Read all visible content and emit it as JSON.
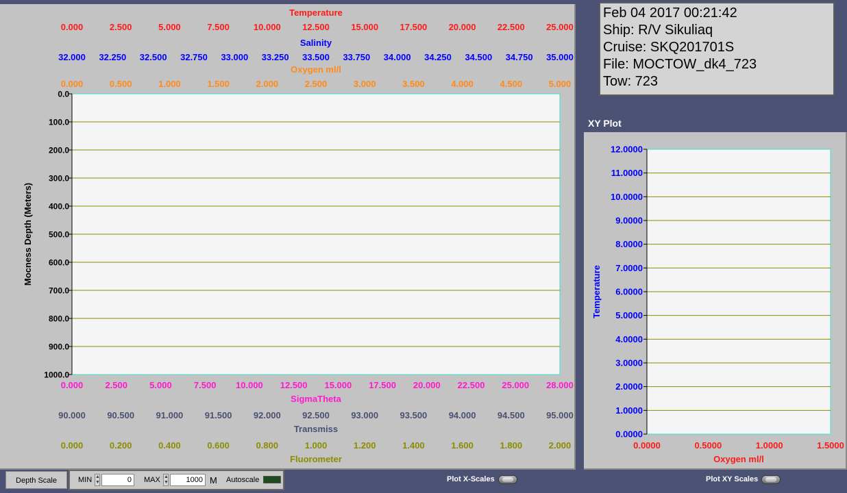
{
  "info": {
    "datetime": "Feb 04 2017 00:21:42",
    "ship": "Ship: R/V Sikuliaq",
    "cruise": "Cruise: SKQ201701S",
    "file": "File: MOCTOW_dk4_723",
    "tow": "Tow: 723"
  },
  "xy_panel_title": "XY Plot",
  "colors": {
    "temperature": "#ff1a1a",
    "salinity": "#0000ff",
    "oxygen": "#ff8a1a",
    "sigma_theta": "#ff1acd",
    "transmiss": "#4a5070",
    "fluorometer": "#8c8c00",
    "grid": "#8c8c00",
    "plot_bg": "#f5f5f5",
    "depth_axis": "#000000"
  },
  "chart_data": [
    {
      "type": "line",
      "ylabel": "Mocness Depth (Meters)",
      "ylim": [
        0,
        1000
      ],
      "y_ticks": [
        "0.0",
        "100.0",
        "200.0",
        "300.0",
        "400.0",
        "500.0",
        "600.0",
        "700.0",
        "800.0",
        "900.0",
        "1000.0"
      ],
      "y_inverted": true,
      "grid": true,
      "series": [],
      "top_axes": [
        {
          "name": "Temperature",
          "color_key": "temperature",
          "xlim": [
            0,
            25
          ],
          "ticks": [
            "0.000",
            "2.500",
            "5.000",
            "7.500",
            "10.000",
            "12.500",
            "15.000",
            "17.500",
            "20.000",
            "22.500",
            "25.000"
          ]
        },
        {
          "name": "Salinity",
          "color_key": "salinity",
          "xlim": [
            32,
            35
          ],
          "ticks": [
            "32.000",
            "32.250",
            "32.500",
            "32.750",
            "33.000",
            "33.250",
            "33.500",
            "33.750",
            "34.000",
            "34.250",
            "34.500",
            "34.750",
            "35.000"
          ]
        },
        {
          "name": "Oxygen ml/l",
          "color_key": "oxygen",
          "xlim": [
            0,
            5
          ],
          "ticks": [
            "0.000",
            "0.500",
            "1.000",
            "1.500",
            "2.000",
            "2.500",
            "3.000",
            "3.500",
            "4.000",
            "4.500",
            "5.000"
          ]
        }
      ],
      "bottom_axes": [
        {
          "name": "SigmaTheta",
          "color_key": "sigma_theta",
          "xlim": [
            0,
            28
          ],
          "ticks": [
            "0.000",
            "2.500",
            "5.000",
            "7.500",
            "10.000",
            "12.500",
            "15.000",
            "17.500",
            "20.000",
            "22.500",
            "25.000",
            "28.000"
          ]
        },
        {
          "name": "Transmiss",
          "color_key": "transmiss",
          "xlim": [
            90,
            95
          ],
          "ticks": [
            "90.000",
            "90.500",
            "91.000",
            "91.500",
            "92.000",
            "92.500",
            "93.000",
            "93.500",
            "94.000",
            "94.500",
            "95.000"
          ]
        },
        {
          "name": "Fluorometer",
          "color_key": "fluorometer",
          "xlim": [
            0,
            2
          ],
          "ticks": [
            "0.000",
            "0.200",
            "0.400",
            "0.600",
            "0.800",
            "1.000",
            "1.200",
            "1.400",
            "1.600",
            "1.800",
            "2.000"
          ]
        }
      ]
    },
    {
      "type": "scatter",
      "xlabel": "Oxygen ml/l",
      "ylabel": "Temperature",
      "xlim": [
        0,
        1.5
      ],
      "ylim": [
        0,
        12
      ],
      "x_ticks": [
        "0.0000",
        "0.5000",
        "1.0000",
        "1.5000"
      ],
      "y_ticks": [
        "0.0000",
        "1.0000",
        "2.0000",
        "3.0000",
        "4.0000",
        "5.0000",
        "6.0000",
        "7.0000",
        "8.0000",
        "9.0000",
        "10.0000",
        "11.0000",
        "12.0000"
      ],
      "grid": true,
      "series": []
    }
  ],
  "controls": {
    "depth_scale_label": "Depth Scale",
    "min_label": "MIN",
    "min_value": "0",
    "max_label": "MAX",
    "max_value": "1000",
    "unit": "M",
    "autoscale_label": "Autoscale",
    "plot_x_scales_label": "Plot X-Scales",
    "plot_xy_scales_label": "Plot XY Scales"
  }
}
